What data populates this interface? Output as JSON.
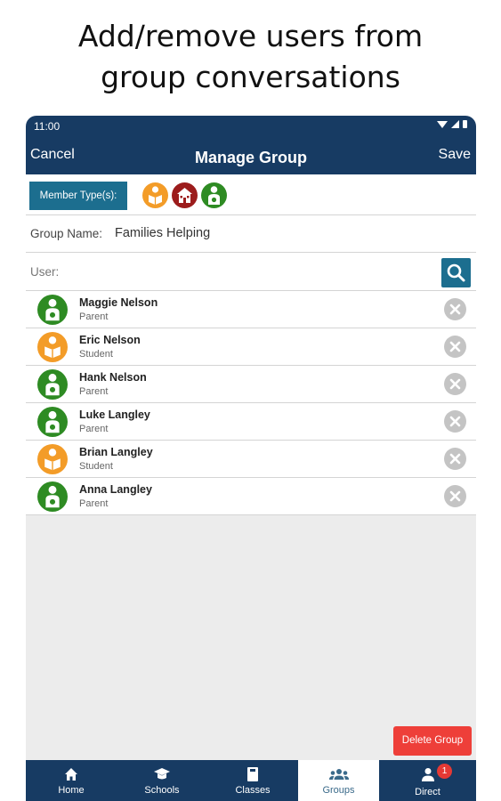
{
  "headline": {
    "line1": "Add/remove users from",
    "line2": "group conversations"
  },
  "status_bar": {
    "time": "11:00",
    "icons": [
      "wifi-icon",
      "signal-icon",
      "battery-icon"
    ]
  },
  "header": {
    "cancel_label": "Cancel",
    "title": "Manage Group",
    "save_label": "Save"
  },
  "member_types": {
    "button_label": "Member Type(s):",
    "icons": [
      {
        "name": "student-icon",
        "color": "#f39c28"
      },
      {
        "name": "school-icon",
        "color": "#9c1c1c"
      },
      {
        "name": "parent-icon",
        "color": "#2e8b23"
      }
    ]
  },
  "group_name": {
    "label": "Group Name:",
    "value": "Families Helping"
  },
  "user_search": {
    "label": "User:",
    "placeholder": "",
    "search_icon": "search-icon"
  },
  "members": [
    {
      "name": "Maggie Nelson",
      "role": "Parent"
    },
    {
      "name": "Eric Nelson",
      "role": "Student"
    },
    {
      "name": "Hank Nelson",
      "role": "Parent"
    },
    {
      "name": "Luke Langley",
      "role": "Parent"
    },
    {
      "name": "Brian Langley",
      "role": "Student"
    },
    {
      "name": "Anna Langley",
      "role": "Parent"
    }
  ],
  "delete_label": "Delete Group",
  "tabs": [
    {
      "label": "Home",
      "icon": "home-icon"
    },
    {
      "label": "Schools",
      "icon": "graduation-cap-icon"
    },
    {
      "label": "Classes",
      "icon": "book-icon"
    },
    {
      "label": "Groups",
      "icon": "group-icon",
      "active": true
    },
    {
      "label": "Direct",
      "icon": "person-icon",
      "badge": "1"
    }
  ],
  "colors": {
    "header_bg": "#173b63",
    "accent": "#1c6e8f",
    "parent": "#2e8b23",
    "student": "#f39c28",
    "school": "#9c1c1c",
    "delete": "#ee3f39",
    "badge": "#e53935"
  }
}
